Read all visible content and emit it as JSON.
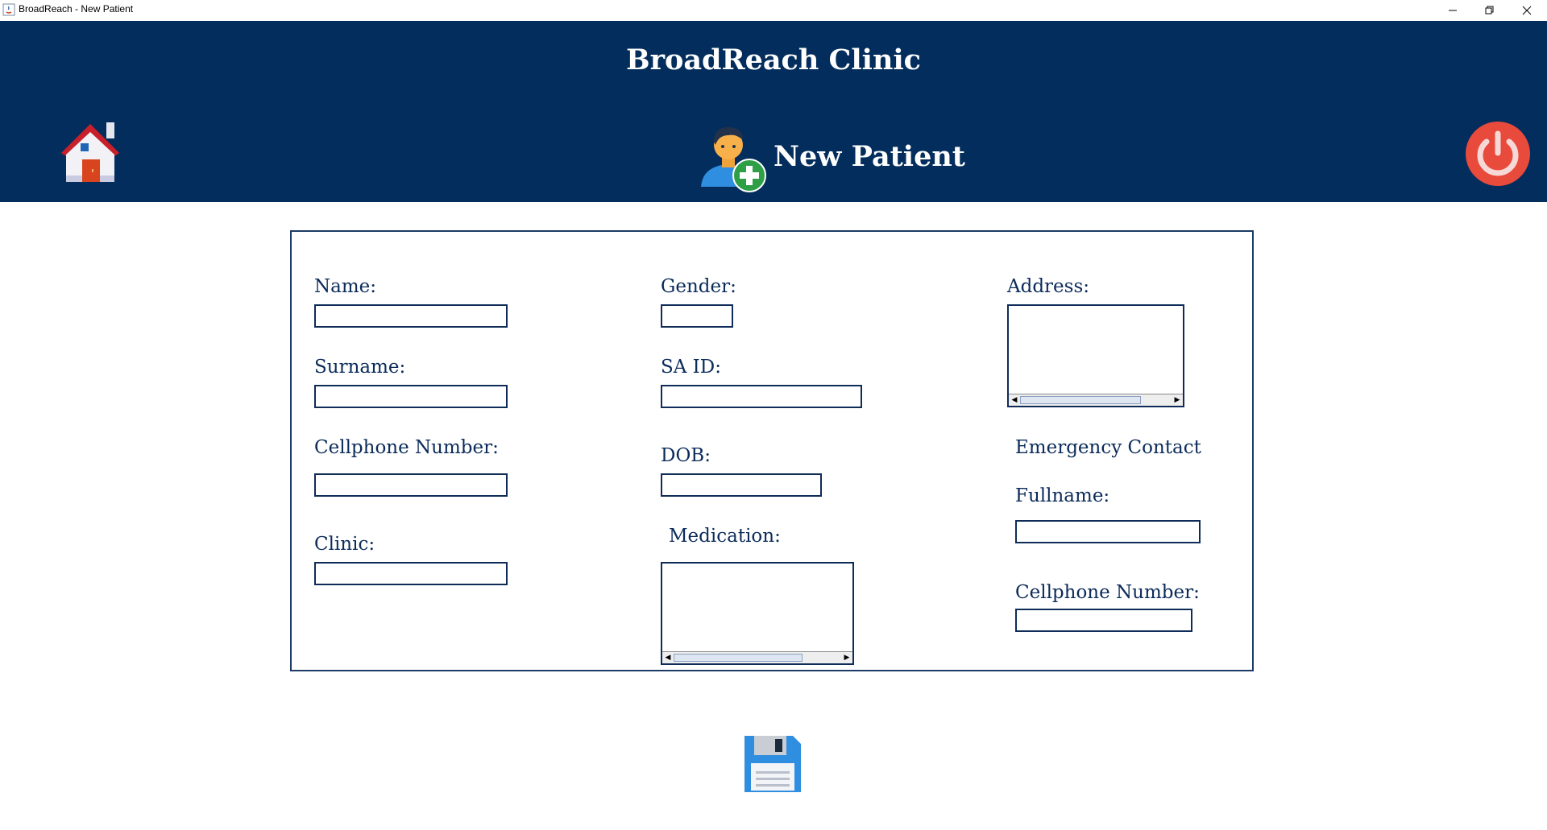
{
  "window": {
    "title": "BroadReach - New Patient",
    "controls": [
      "minimize",
      "restore",
      "close"
    ]
  },
  "header": {
    "clinic_title": "BroadReach Clinic",
    "page_title": "New Patient"
  },
  "icons": {
    "home": "home-icon",
    "patient": "add-patient-icon",
    "power": "power-icon",
    "save": "save-floppy-icon"
  },
  "form": {
    "name": {
      "label": "Name:",
      "value": ""
    },
    "surname": {
      "label": "Surname:",
      "value": ""
    },
    "cellphone": {
      "label": "Cellphone Number:",
      "value": ""
    },
    "clinic": {
      "label": "Clinic:",
      "value": ""
    },
    "gender": {
      "label": "Gender:",
      "value": ""
    },
    "sa_id": {
      "label": "SA ID:",
      "value": ""
    },
    "dob": {
      "label": "DOB:",
      "value": ""
    },
    "medication": {
      "label": "Medication:",
      "value": ""
    },
    "address": {
      "label": "Address:",
      "value": ""
    },
    "emergency": {
      "heading": "Emergency Contact",
      "fullname": {
        "label": "Fullname:",
        "value": ""
      },
      "cellphone": {
        "label": "Cellphone Number:",
        "value": ""
      }
    }
  },
  "colors": {
    "header_bg": "#032d5c",
    "field_border": "#0e2c57",
    "power_red": "#e84a3c"
  }
}
